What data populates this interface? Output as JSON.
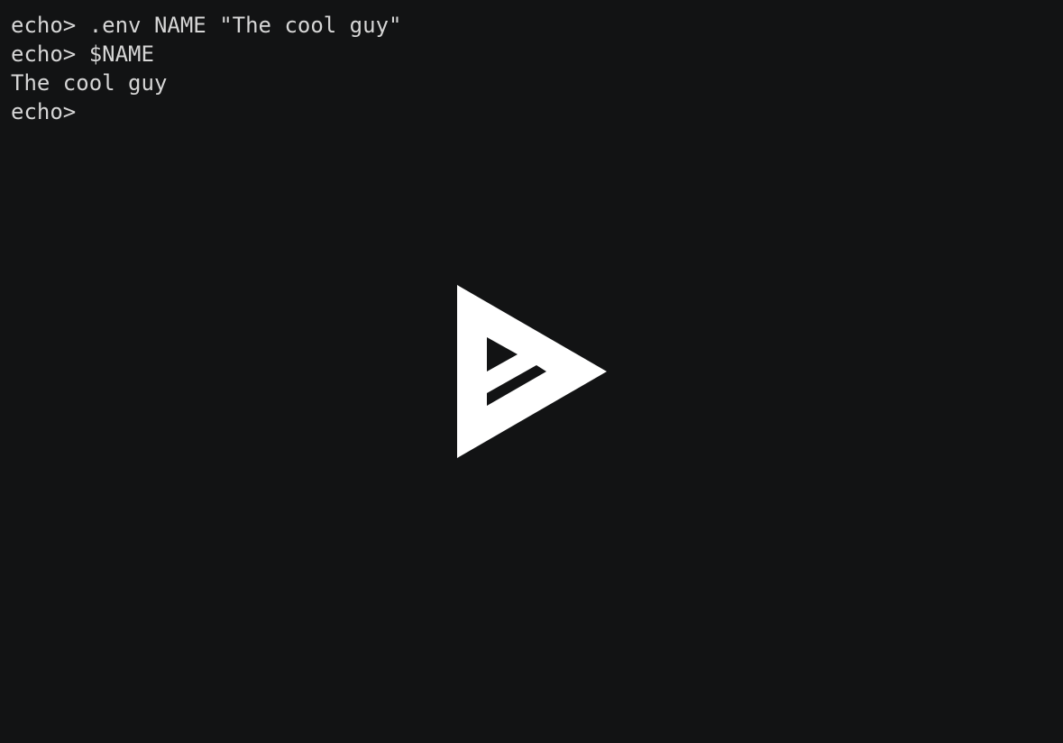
{
  "terminal": {
    "lines": [
      {
        "prompt": "echo>",
        "text": " .env NAME \"The cool guy\""
      },
      {
        "prompt": "echo>",
        "text": " $NAME"
      },
      {
        "prompt": "",
        "text": "The cool guy"
      },
      {
        "prompt": "echo>",
        "text": ""
      }
    ]
  },
  "overlay": {
    "icon": "asciinema-play-icon"
  },
  "colors": {
    "background": "#121314",
    "foreground": "#d6d6d6",
    "play_icon": "#ffffff"
  }
}
